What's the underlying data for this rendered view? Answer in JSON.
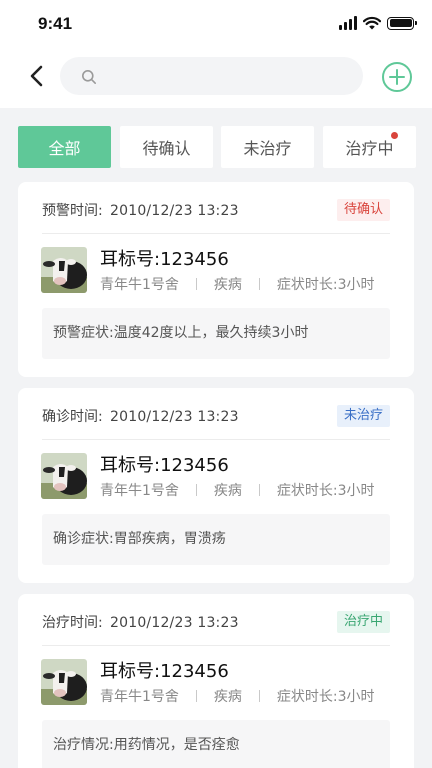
{
  "status_bar": {
    "time": "9:41"
  },
  "search": {
    "placeholder": ""
  },
  "tabs": [
    {
      "label": "全部",
      "active": true,
      "has_dot": false
    },
    {
      "label": "待确认",
      "active": false,
      "has_dot": false
    },
    {
      "label": "未治疗",
      "active": false,
      "has_dot": false
    },
    {
      "label": "治疗中",
      "active": false,
      "has_dot": true
    }
  ],
  "cards": [
    {
      "time_label": "预警时间:",
      "time_value": "2010/12/23  13:23",
      "badge": "待确认",
      "badge_type": "pending",
      "ear_tag": "耳标号:123456",
      "barn": "青年牛1号舍",
      "disease": "疾病",
      "duration": "症状时长:3小时",
      "note": "预警症状:温度42度以上，最久持续3小时"
    },
    {
      "time_label": "确诊时间:",
      "time_value": "2010/12/23  13:23",
      "badge": "未治疗",
      "badge_type": "untreated",
      "ear_tag": "耳标号:123456",
      "barn": "青年牛1号舍",
      "disease": "疾病",
      "duration": "症状时长:3小时",
      "note": "确诊症状:胃部疾病，胃溃疡"
    },
    {
      "time_label": "治疗时间:",
      "time_value": "2010/12/23  13:23",
      "badge": "治疗中",
      "badge_type": "treating",
      "ear_tag": "耳标号:123456",
      "barn": "青年牛1号舍",
      "disease": "疾病",
      "duration": "症状时长:3小时",
      "note": "治疗情况:用药情况，是否痊愈"
    }
  ],
  "colors": {
    "accent": "#5fc898",
    "badge_pending": "#d9443c",
    "badge_untreated": "#3a6fc6",
    "badge_treating": "#3aa672",
    "background": "#f2f3f5"
  },
  "icons": {
    "back": "chevron-left-icon",
    "search": "search-icon",
    "add": "plus-circle-icon"
  }
}
